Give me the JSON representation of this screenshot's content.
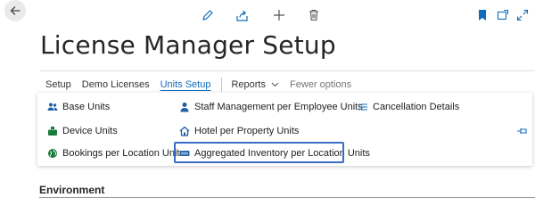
{
  "page": {
    "title": "License Manager Setup"
  },
  "toolbar": {
    "icons": [
      "back-arrow-icon",
      "edit-pencil-icon",
      "share-icon",
      "add-plus-icon",
      "delete-trash-icon",
      "bookmark-icon",
      "open-new-window-icon",
      "expand-icon"
    ]
  },
  "tabs": [
    {
      "label": "Setup"
    },
    {
      "label": "Demo Licenses"
    },
    {
      "label": "Units Setup",
      "active": true
    },
    {
      "label": "Reports"
    },
    {
      "label": "Fewer options"
    }
  ],
  "actions": {
    "base_units": "Base Units",
    "device_units": "Device Units",
    "bookings_per_location_units": "Bookings per Location Units",
    "staff_management_per_employee_units": "Staff Management per Employee Units",
    "hotel_per_property_units": "Hotel per Property Units",
    "aggregated_inventory_per_location_units": "Aggregated Inventory per Location Units",
    "cancellation_details": "Cancellation Details"
  },
  "section": {
    "environment": "Environment"
  },
  "colors": {
    "accent": "#0f6cbd",
    "highlight_border": "#3a6cc9",
    "icon_blue": "#1f5fa8"
  }
}
